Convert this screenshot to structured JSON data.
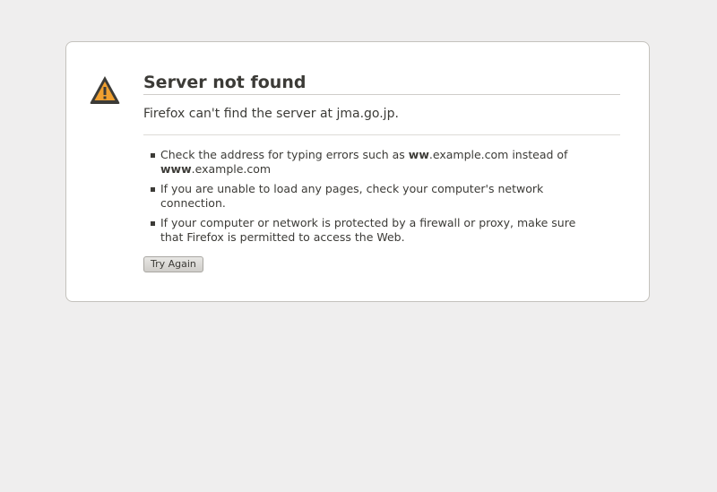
{
  "error": {
    "title": "Server not found",
    "short_desc": "Firefox can't find the server at jma.go.jp.",
    "suggestions": [
      {
        "pre": "Check the address for typing errors such as ",
        "bold1": "ww",
        "mid": ".example.com instead of ",
        "bold2": "www",
        "post": ".example.com"
      },
      {
        "text": "If you are unable to load any pages, check your computer's network connection."
      },
      {
        "text": "If your computer or network is protected by a firewall or proxy, make sure that Firefox is permitted to access the Web."
      }
    ],
    "try_again_label": "Try Again",
    "icon": "warning-triangle-icon",
    "colors": {
      "icon_fill": "#f0a030",
      "icon_outline": "#3c3b37",
      "background": "#efeeee"
    }
  }
}
